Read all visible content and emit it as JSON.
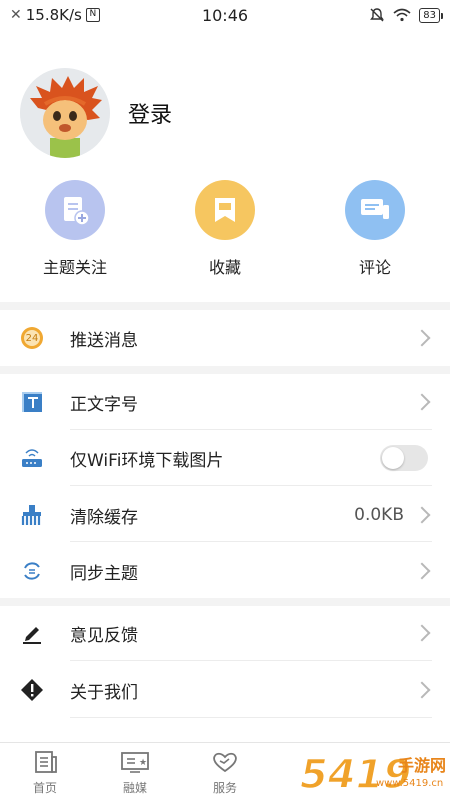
{
  "status_bar": {
    "speed": "15.8K/s",
    "time": "10:46",
    "battery": "83"
  },
  "profile": {
    "login_label": "登录"
  },
  "quick_actions": [
    {
      "label": "主题关注",
      "icon": "topic-follow-icon",
      "color": "#b8c4ef"
    },
    {
      "label": "收藏",
      "icon": "favorites-icon",
      "color": "#f6c660"
    },
    {
      "label": "评论",
      "icon": "comments-icon",
      "color": "#8fc0f2"
    }
  ],
  "settings": {
    "push": {
      "label": "推送消息",
      "badge": "24"
    },
    "font_size": {
      "label": "正文字号"
    },
    "wifi_images": {
      "label": "仅WiFi环境下载图片",
      "enabled": false
    },
    "clear_cache": {
      "label": "清除缓存",
      "value": "0.0KB"
    },
    "sync_topics": {
      "label": "同步主题"
    },
    "feedback": {
      "label": "意见反馈"
    },
    "about": {
      "label": "关于我们"
    }
  },
  "tabbar": [
    {
      "label": "首页",
      "icon": "home-news-icon"
    },
    {
      "label": "融媒",
      "icon": "media-icon"
    },
    {
      "label": "服务",
      "icon": "service-heart-icon"
    }
  ],
  "watermark": {
    "text_main": "5419",
    "text_site": "手游网",
    "text_domain": "www.5419.cn"
  },
  "colors": {
    "accent_orange": "#f0a832",
    "blue_icon": "#3a7fc6",
    "separator": "#f3f3f3"
  }
}
